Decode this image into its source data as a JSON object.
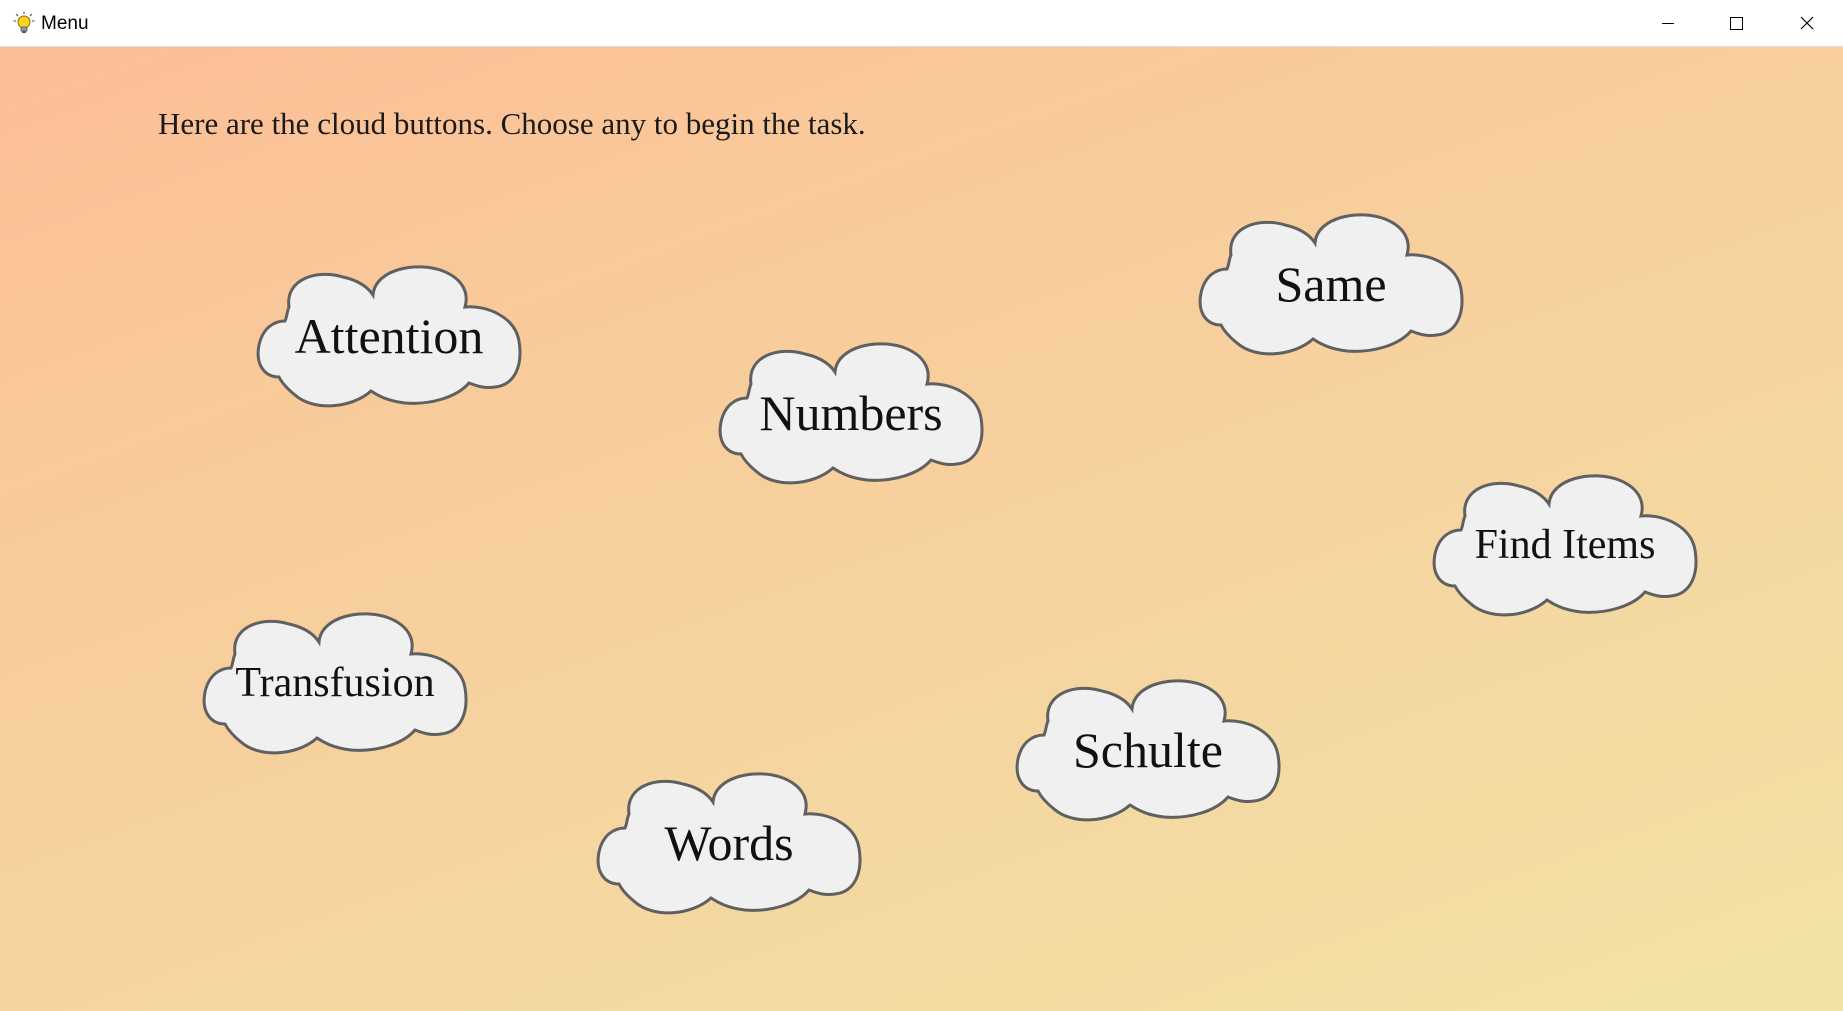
{
  "window": {
    "title": "Menu",
    "app_icon": "lightbulb-icon",
    "controls": {
      "minimize_icon": "minimize-icon",
      "maximize_icon": "maximize-icon",
      "close_icon": "close-icon"
    }
  },
  "main": {
    "instruction": "Here are the cloud buttons. Choose any to begin the task.",
    "clouds": {
      "attention": "Attention",
      "numbers": "Numbers",
      "same": "Same",
      "find_items": "Find Items",
      "transfusion": "Transfusion",
      "schulte": "Schulte",
      "words": "Words"
    }
  },
  "colors": {
    "cloud_fill": "#f0f0f0",
    "cloud_stroke": "#606060",
    "gradient_start": "#fcbd96",
    "gradient_end": "#f1e3a6"
  }
}
